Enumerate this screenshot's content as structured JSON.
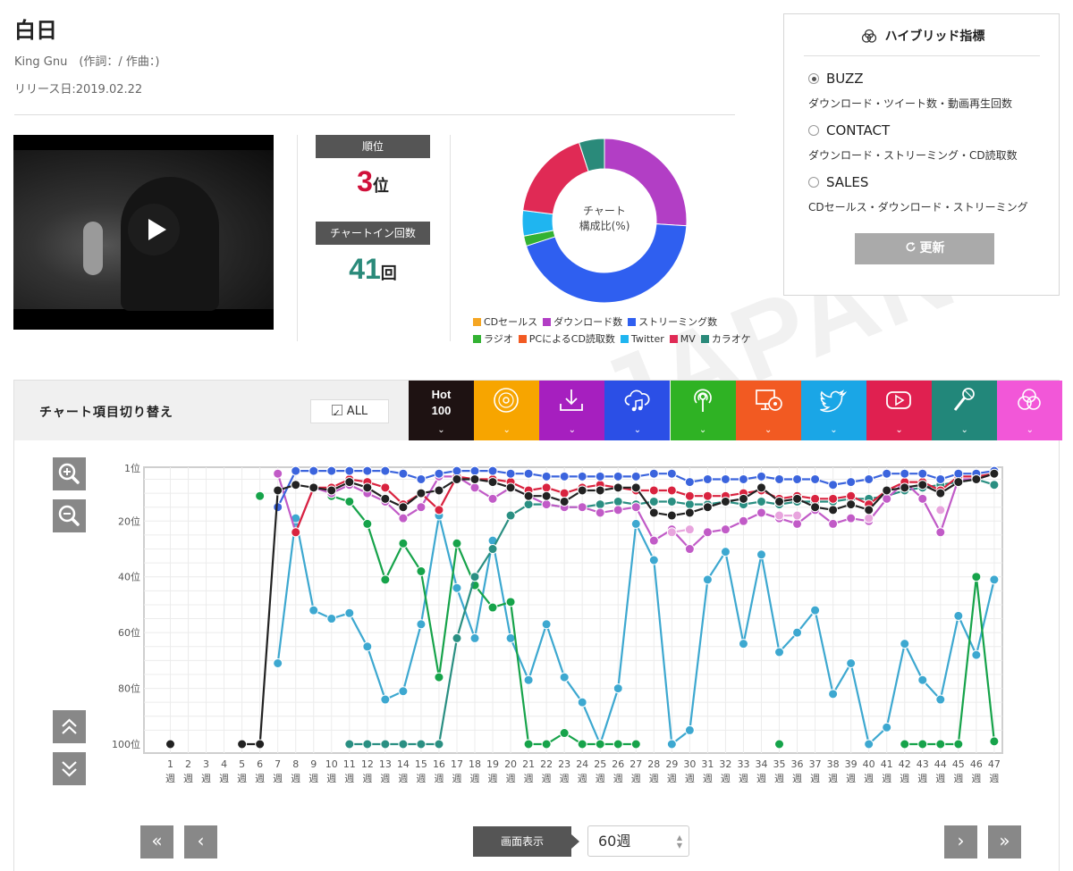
{
  "song": {
    "title": "白日",
    "artist_credits": "King Gnu　(作詞：/ 作曲：)",
    "release": "リリース日:2019.02.22"
  },
  "watermark": "JAPAN",
  "stats": {
    "rank_label": "順位",
    "rank_value": "3",
    "rank_unit": "位",
    "rank_color": "#d0103a",
    "chartin_label": "チャートイン回数",
    "chartin_value": "41",
    "chartin_unit": "回",
    "chartin_color": "#2a8a7a"
  },
  "composition": {
    "center_line1": "チャート",
    "center_line2": "構成比(%)",
    "segments": [
      {
        "name": "CDセールス",
        "color": "#f5a623",
        "value": 0
      },
      {
        "name": "ダウンロード数",
        "color": "#b23ec5",
        "value": 26
      },
      {
        "name": "ストリーミング数",
        "color": "#2f5ff0",
        "value": 44
      },
      {
        "name": "ラジオ",
        "color": "#33b233",
        "value": 2
      },
      {
        "name": "PCによるCD読取数",
        "color": "#f25a22",
        "value": 0
      },
      {
        "name": "Twitter",
        "color": "#1fb5f0",
        "value": 5
      },
      {
        "name": "MV",
        "color": "#e02a55",
        "value": 18
      },
      {
        "name": "カラオケ",
        "color": "#2a8a7a",
        "value": 5
      }
    ]
  },
  "hybrid": {
    "title": "ハイブリッド指標",
    "options": [
      {
        "label": "BUZZ",
        "desc": "ダウンロード・ツイート数・動画再生回数",
        "selected": true
      },
      {
        "label": "CONTACT",
        "desc": "ダウンロード・ストリーミング・CD読取数",
        "selected": false
      },
      {
        "label": "SALES",
        "desc": "CDセールス・ダウンロード・ストリーミング",
        "selected": false
      }
    ],
    "refresh_label": "更新"
  },
  "panel": {
    "switch_label": "チャート項目切り替え",
    "all_label": "ALL",
    "tabs": [
      {
        "name": "hot100",
        "icon": "hot100",
        "line1": "Hot",
        "line2": "100",
        "color": "#1e1212"
      },
      {
        "name": "cd-sales",
        "icon": "disc",
        "color": "#f7a500"
      },
      {
        "name": "download",
        "icon": "download",
        "color": "#a61fbf"
      },
      {
        "name": "streaming",
        "icon": "cloud-music",
        "color": "#2b4fe6"
      },
      {
        "name": "radio",
        "icon": "radio",
        "color": "#2fb224"
      },
      {
        "name": "pc-cd-read",
        "icon": "monitor-disc",
        "color": "#f25a22"
      },
      {
        "name": "twitter",
        "icon": "twitter-bird",
        "color": "#1aa6e6"
      },
      {
        "name": "mv",
        "icon": "youtube-play",
        "color": "#e02050"
      },
      {
        "name": "karaoke",
        "icon": "microphone",
        "color": "#22877a"
      },
      {
        "name": "hybrid",
        "icon": "circles",
        "color": "#f257d8"
      }
    ],
    "chevron": "⌄",
    "display_label": "画面表示",
    "weeks_value": "60週"
  },
  "chart_data": {
    "type": "line",
    "y_axis": {
      "reversed": true,
      "ylim": [
        1,
        100
      ],
      "ticks": [
        1,
        20,
        40,
        60,
        80,
        100
      ],
      "tick_labels": [
        "1位",
        "20位",
        "40位",
        "60位",
        "80位",
        "100位"
      ]
    },
    "x_top": [
      "1",
      "2",
      "3",
      "4",
      "5",
      "6",
      "7",
      "8",
      "9",
      "10",
      "11",
      "12",
      "13",
      "14",
      "15",
      "16",
      "17",
      "18",
      "19",
      "20",
      "21",
      "22",
      "23",
      "24",
      "25",
      "26",
      "27",
      "28",
      "29",
      "30",
      "31",
      "32",
      "33",
      "34",
      "35",
      "36",
      "37",
      "38",
      "39",
      "40",
      "41",
      "42",
      "43",
      "44",
      "45",
      "46",
      "47"
    ],
    "x_bottom": "週",
    "grid": true,
    "series": [
      {
        "color": "#3da8d0",
        "values": [
          null,
          null,
          null,
          null,
          null,
          null,
          71,
          19,
          52,
          55,
          53,
          65,
          84,
          81,
          57,
          18,
          44,
          62,
          27,
          62,
          77,
          57,
          76,
          85,
          100,
          80,
          21,
          34,
          100,
          95,
          41,
          31,
          64,
          32,
          67,
          60,
          52,
          82,
          71,
          100,
          94,
          64,
          77,
          84,
          54,
          68,
          41
        ]
      },
      {
        "color": "#16a34a",
        "values": [
          null,
          null,
          null,
          null,
          null,
          11,
          null,
          null,
          null,
          11,
          13,
          21,
          41,
          28,
          38,
          76,
          28,
          43,
          51,
          49,
          100,
          100,
          96,
          100,
          100,
          100,
          100,
          null,
          null,
          null,
          null,
          null,
          null,
          null,
          100,
          null,
          null,
          null,
          null,
          null,
          null,
          100,
          100,
          100,
          100,
          40,
          99
        ]
      },
      {
        "color": "#2a8f82",
        "values": [
          null,
          null,
          null,
          null,
          null,
          null,
          null,
          null,
          null,
          null,
          100,
          100,
          100,
          100,
          100,
          100,
          62,
          40,
          30,
          18,
          14,
          14,
          15,
          15,
          14,
          13,
          14,
          13,
          13,
          14,
          14,
          13,
          14,
          13,
          14,
          13,
          13,
          13,
          12,
          12,
          11,
          9,
          8,
          7,
          6,
          5,
          7
        ]
      },
      {
        "color": "#c15bc7",
        "values": [
          null,
          null,
          null,
          null,
          null,
          null,
          3,
          24,
          8,
          10,
          7,
          10,
          13,
          19,
          15,
          4,
          4,
          8,
          12,
          8,
          11,
          14,
          15,
          15,
          17,
          16,
          15,
          27,
          23,
          30,
          24,
          23,
          20,
          17,
          19,
          21,
          16,
          21,
          19,
          20,
          12,
          6,
          12,
          24,
          5,
          5,
          3
        ]
      },
      {
        "color": "#e8a5de",
        "values": [
          null,
          null,
          null,
          null,
          null,
          null,
          null,
          null,
          null,
          null,
          null,
          null,
          null,
          null,
          null,
          null,
          null,
          null,
          null,
          null,
          null,
          null,
          null,
          null,
          null,
          null,
          null,
          null,
          24,
          23,
          null,
          null,
          null,
          null,
          18,
          18,
          null,
          null,
          null,
          19,
          null,
          null,
          null,
          16,
          null,
          null,
          null
        ]
      },
      {
        "color": "#d9233f",
        "values": [
          null,
          null,
          null,
          null,
          null,
          null,
          null,
          24,
          8,
          8,
          5,
          6,
          8,
          14,
          10,
          16,
          4,
          5,
          5,
          6,
          9,
          8,
          10,
          8,
          7,
          8,
          9,
          9,
          9,
          11,
          11,
          11,
          10,
          9,
          12,
          11,
          12,
          12,
          11,
          14,
          9,
          6,
          6,
          9,
          4,
          4,
          3
        ]
      },
      {
        "color": "#3b64dd",
        "values": [
          null,
          null,
          null,
          null,
          null,
          null,
          15,
          2,
          2,
          2,
          2,
          2,
          2,
          3,
          5,
          3,
          2,
          2,
          2,
          3,
          3,
          4,
          4,
          4,
          4,
          4,
          4,
          3,
          3,
          6,
          5,
          5,
          5,
          4,
          5,
          5,
          5,
          7,
          6,
          5,
          3,
          3,
          3,
          5,
          3,
          3,
          2
        ]
      },
      {
        "color": "#222222",
        "values": [
          100,
          null,
          null,
          null,
          100,
          100,
          9,
          7,
          8,
          9,
          6,
          8,
          12,
          15,
          10,
          9,
          5,
          5,
          6,
          8,
          11,
          11,
          13,
          9,
          9,
          8,
          8,
          17,
          18,
          17,
          15,
          13,
          12,
          8,
          13,
          12,
          15,
          16,
          14,
          16,
          9,
          8,
          7,
          10,
          6,
          5,
          3
        ]
      }
    ]
  }
}
